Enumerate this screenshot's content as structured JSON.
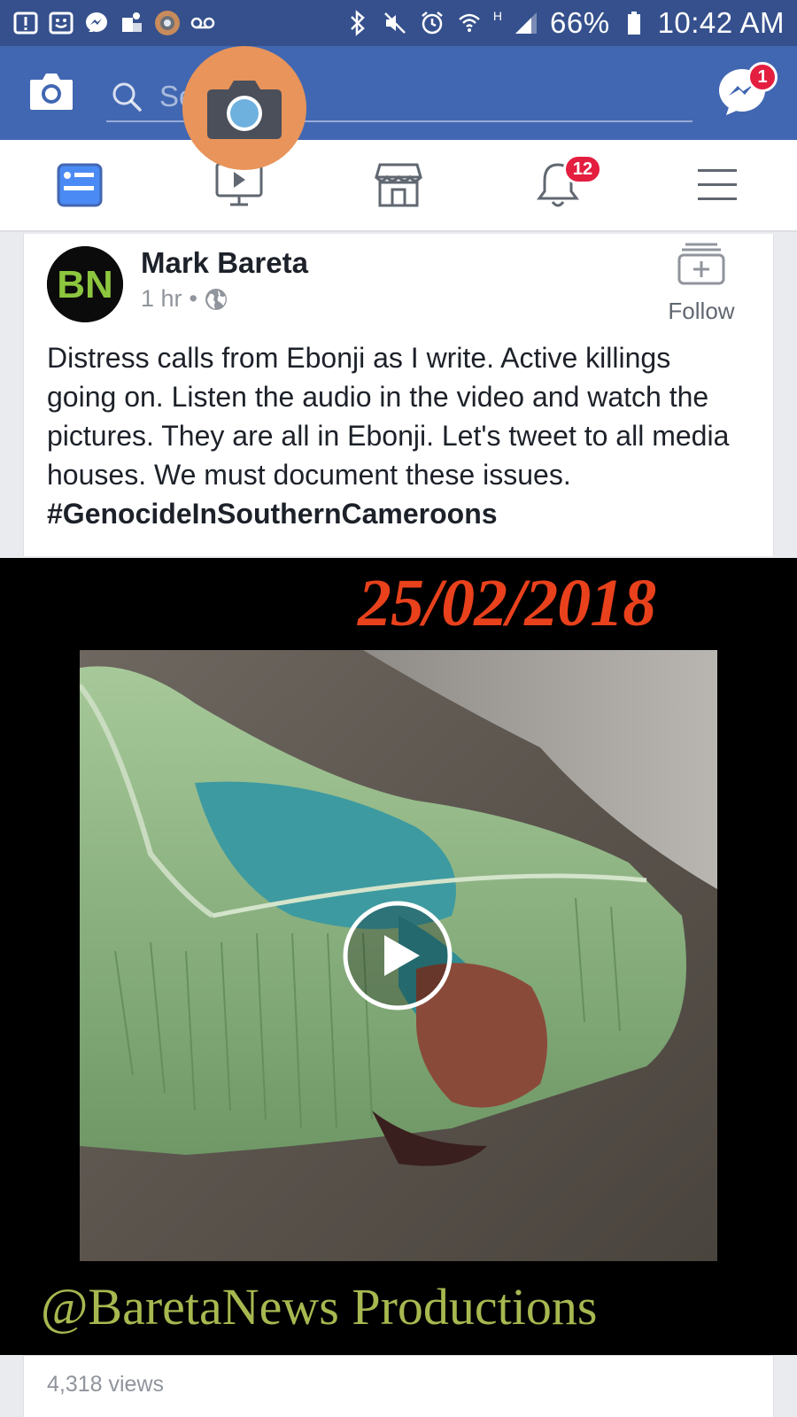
{
  "status_bar": {
    "battery": "66%",
    "time": "10:42 AM",
    "network": "H",
    "icons_left": [
      "alert-square-icon",
      "smiley-square-icon",
      "messenger-icon",
      "apps-icon",
      "camera-circle-icon",
      "voicemail-icon"
    ],
    "icons_right": [
      "bluetooth-icon",
      "mute-icon",
      "alarm-icon",
      "wifi-icon",
      "signal-icon",
      "battery-icon"
    ]
  },
  "app_bar": {
    "search_placeholder": "Search",
    "messenger_badge": "1"
  },
  "tabs": {
    "items": [
      "news-feed",
      "watch",
      "marketplace",
      "notifications",
      "menu"
    ],
    "notifications_badge": "12",
    "active": "news-feed"
  },
  "post": {
    "author": "Mark Bareta",
    "time": "1 hr",
    "separator": "•",
    "follow_label": "Follow",
    "text": "Distress calls from Ebonji as I write. Active killings going on. Listen the audio in the video and watch the pictures. They are all in Ebonji. Let's tweet to all media houses. We must document these issues.",
    "hashtag": "#GenocideInSouthernCameroons",
    "avatar_text": "BN",
    "video": {
      "date_overlay": "25/02/2018",
      "credit_overlay": "@BaretaNews Productions"
    },
    "views": "4,318 views"
  },
  "colors": {
    "brand_blue": "#4267b2",
    "status_bar_blue": "#35508c",
    "badge_red": "#e41e3f",
    "date_overlay": "#e8411c",
    "credit_overlay": "#a7b850",
    "bubble_orange": "#e8945a"
  }
}
